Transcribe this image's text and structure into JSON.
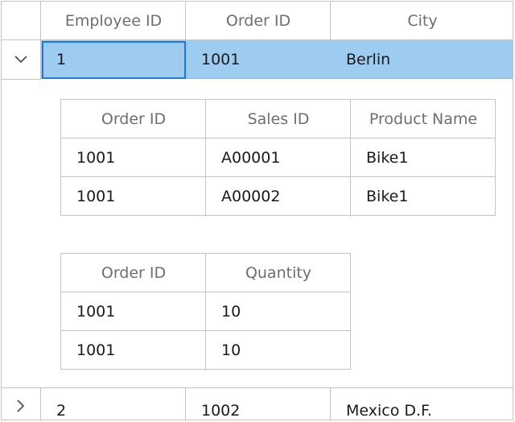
{
  "columns": [
    "Employee ID",
    "Order ID",
    "City"
  ],
  "rows": [
    {
      "employee_id": "1",
      "order_id": "1001",
      "city": "Berlin",
      "expanded": true
    },
    {
      "employee_id": "2",
      "order_id": "1002",
      "city": "Mexico D.F.",
      "expanded": false
    }
  ],
  "detail_table_1": {
    "columns": [
      "Order ID",
      "Sales ID",
      "Product Name"
    ],
    "rows": [
      [
        "1001",
        "A00001",
        "Bike1"
      ],
      [
        "1001",
        "A00002",
        "Bike1"
      ]
    ]
  },
  "detail_table_2": {
    "columns": [
      "Order ID",
      "Quantity"
    ],
    "rows": [
      [
        "1001",
        "10"
      ],
      [
        "1001",
        "10"
      ]
    ]
  },
  "colors": {
    "selection": "#9ecbf0",
    "focus_border": "#1f78d1",
    "grid_line": "#c4c4c4",
    "header_text": "#6e6e6e"
  },
  "icons": {
    "expanded": "chevron-down-icon",
    "collapsed": "chevron-right-icon"
  }
}
